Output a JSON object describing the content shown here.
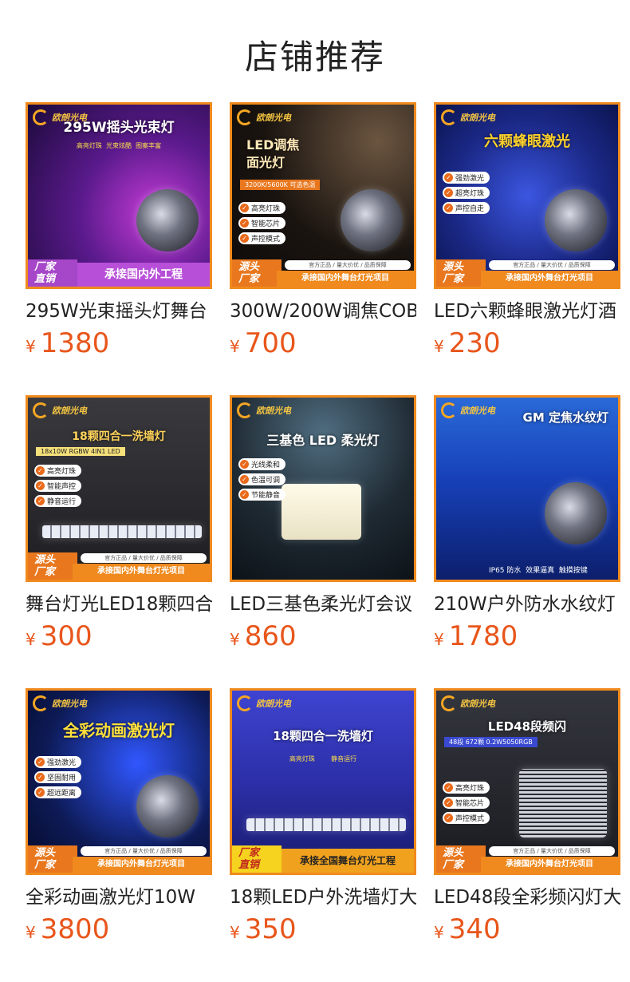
{
  "header": {
    "title": "店铺推荐"
  },
  "products": [
    {
      "name": "295W光束摇头灯舞台",
      "currency": "¥",
      "price": "1380",
      "image": {
        "logo": "欧朗光电",
        "headline": "295W摇头光束灯",
        "subline": "高亮灯珠  光束炫酷  图案丰富",
        "bullets": [],
        "banner_left": "厂家\n直销",
        "banner_right": "承接国内外工程",
        "banner_top": "",
        "bg": "#5a1a8c"
      }
    },
    {
      "name": "300W/200W调焦COB",
      "currency": "¥",
      "price": "700",
      "image": {
        "logo": "欧朗光电",
        "headline": "LED调焦\n面光灯",
        "subline": "3200K/5600K 可选色温",
        "bullets": [
          "高亮灯珠",
          "智能芯片",
          "声控模式"
        ],
        "banner_left": "源头\n厂家",
        "banner_right": "承接国内外舞台灯光项目",
        "banner_top": "官方正品 / 量大价优 / 品质保障",
        "bg": "#1a1410"
      }
    },
    {
      "name": "LED六颗蜂眼激光灯酒",
      "currency": "¥",
      "price": "230",
      "image": {
        "logo": "欧朗光电",
        "headline": "六颗蜂眼激光",
        "subline": "",
        "bullets": [
          "强劲激光",
          "超亮灯珠",
          "声控自走"
        ],
        "banner_left": "源头\n厂家",
        "banner_right": "承接国内外舞台灯光项目",
        "banner_top": "官方正品 / 量大价优 / 品质保障",
        "bg": "#1c2a8a"
      }
    },
    {
      "name": "舞台灯光LED18颗四合",
      "currency": "¥",
      "price": "300",
      "image": {
        "logo": "欧朗光电",
        "headline": "18颗四合一洗墙灯",
        "subline": "18x10W RGBW 4IN1 LED",
        "bullets": [
          "高亮灯珠",
          "智能声控",
          "静音运行"
        ],
        "banner_left": "源头\n厂家",
        "banner_right": "承接国内外舞台灯光项目",
        "banner_top": "官方正品 / 量大价优 / 品质保障",
        "bg": "#2b2b2e"
      }
    },
    {
      "name": "LED三基色柔光灯会议",
      "currency": "¥",
      "price": "860",
      "image": {
        "logo": "欧朗光电",
        "headline": "三基色 LED 柔光灯",
        "subline": "",
        "bullets": [
          "光线柔和",
          "色温可调",
          "节能静音"
        ],
        "banner_left": "",
        "banner_right": "",
        "banner_top": "",
        "bg": "#1f2a33"
      }
    },
    {
      "name": "210W户外防水水纹灯",
      "currency": "¥",
      "price": "1780",
      "image": {
        "logo": "欧朗光电",
        "headline": "GM 定焦水纹灯",
        "subline": "IP65 防水  效果逼真  触摸按键",
        "bullets": [],
        "banner_left": "",
        "banner_right": "",
        "banner_top": "",
        "bg": "#1740b8"
      }
    },
    {
      "name": "全彩动画激光灯10W",
      "currency": "¥",
      "price": "3800",
      "image": {
        "logo": "欧朗光电",
        "headline": "全彩动画激光灯",
        "subline": "",
        "bullets": [
          "强劲激光",
          "坚固耐用",
          "超远距离"
        ],
        "banner_left": "源头\n厂家",
        "banner_right": "承接国内外舞台灯光项目",
        "banner_top": "官方正品 / 量大价优 / 品质保障",
        "bg": "#0d1a55"
      }
    },
    {
      "name": "18颗LED户外洗墙灯大",
      "currency": "¥",
      "price": "350",
      "image": {
        "logo": "欧朗光电",
        "headline": "18颗四合一洗墙灯",
        "subline": "高亮灯珠        静音运行",
        "bullets": [],
        "banner_left": "厂家\n直销",
        "banner_right": "承接全国舞台灯光工程",
        "banner_top": "",
        "bg": "#2c2fa8"
      }
    },
    {
      "name": "LED48段全彩频闪灯大",
      "currency": "¥",
      "price": "340",
      "image": {
        "logo": "欧朗光电",
        "headline": "LED48段频闪",
        "subline": "48段 672颗 0.2W5050RGB",
        "bullets": [
          "高亮灯珠",
          "智能芯片",
          "声控模式"
        ],
        "banner_left": "源头\n厂家",
        "banner_right": "承接国内外舞台灯光项目",
        "banner_top": "官方正品 / 量大价优 / 品质保障",
        "bg": "#23252b"
      }
    }
  ]
}
